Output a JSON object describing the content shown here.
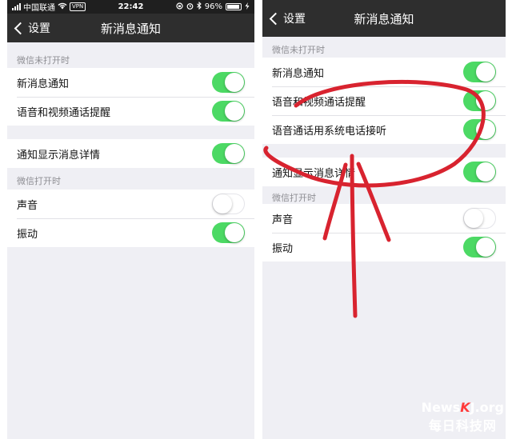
{
  "left": {
    "status": {
      "carrier": "中国联通",
      "vpn": "VPN",
      "time": "22:42",
      "battery": "96%",
      "battery_level": 0.96
    },
    "nav": {
      "back_label": "设置",
      "title": "新消息通知"
    },
    "section1": {
      "header": "微信未打开时",
      "rows": [
        {
          "label": "新消息通知",
          "on": true
        },
        {
          "label": "语音和视频通话提醒",
          "on": true
        }
      ]
    },
    "section2": {
      "rows": [
        {
          "label": "通知显示消息详情",
          "on": true
        }
      ]
    },
    "section3": {
      "header": "微信打开时",
      "rows": [
        {
          "label": "声音",
          "on": false
        },
        {
          "label": "振动",
          "on": true
        }
      ]
    }
  },
  "right": {
    "nav": {
      "back_label": "设置",
      "title": "新消息通知"
    },
    "section1": {
      "header": "微信未打开时",
      "rows": [
        {
          "label": "新消息通知",
          "on": true
        },
        {
          "label": "语音和视频通话提醒",
          "on": true
        },
        {
          "label": "语音通话用系统电话接听",
          "on": true
        }
      ]
    },
    "section2": {
      "rows": [
        {
          "label": "通知显示消息详情",
          "on": true
        }
      ]
    },
    "section3": {
      "header": "微信打开时",
      "rows": [
        {
          "label": "声音",
          "on": false
        },
        {
          "label": "振动",
          "on": true
        }
      ]
    }
  },
  "watermark": {
    "brand_prefix": "News",
    "brand_k": "K",
    "brand_suffix": "J.org",
    "brand_cn": "每日科技网"
  },
  "colors": {
    "toggle_on": "#4cd964",
    "navbar": "#2e2e2e",
    "statusbar": "#1f1f1f",
    "annotation": "#d8232f"
  }
}
